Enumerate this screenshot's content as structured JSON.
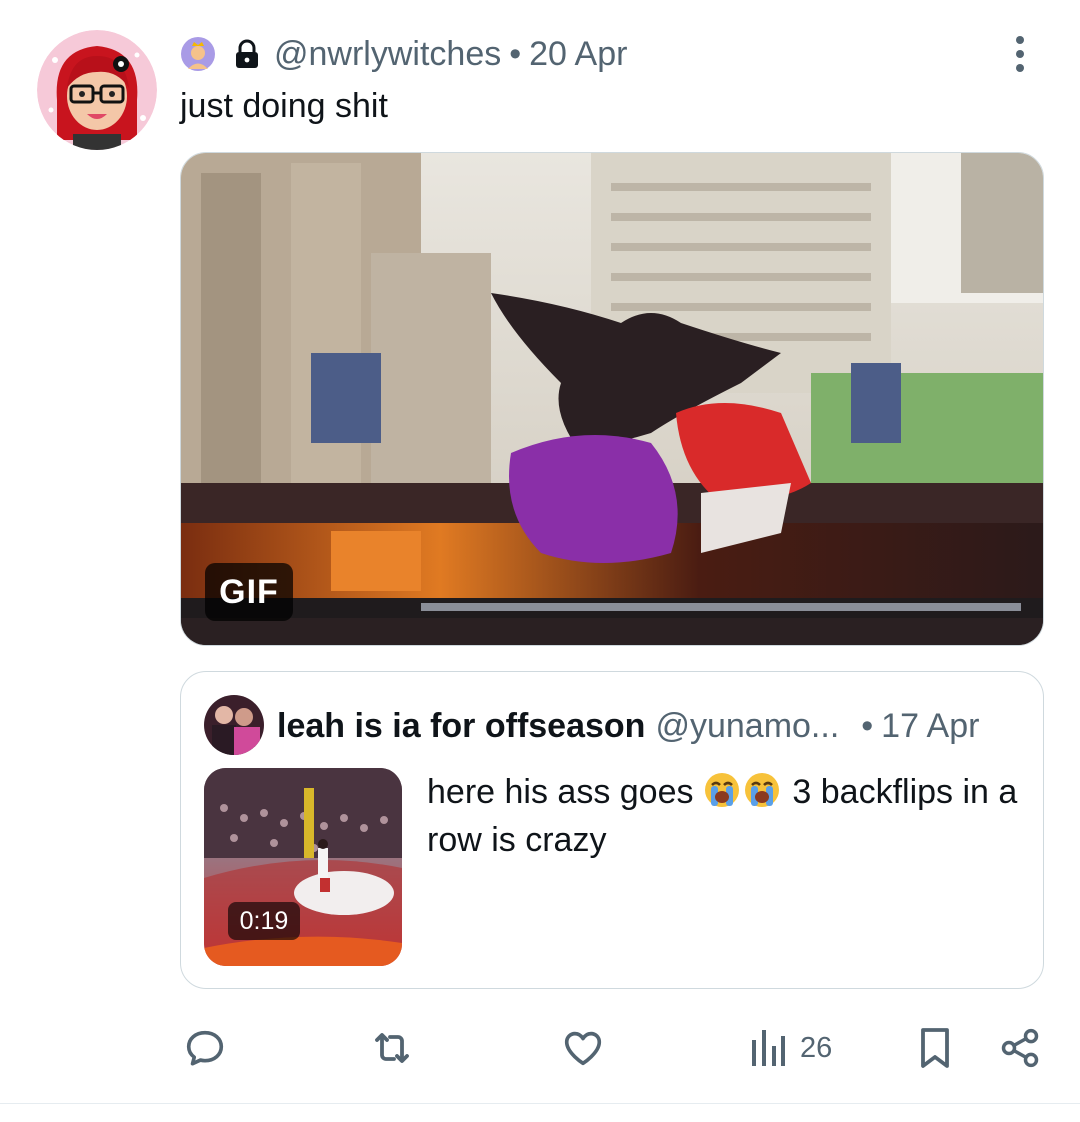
{
  "tweet": {
    "handle": "@nwrlywitches",
    "separator": "•",
    "date": "20 Apr",
    "text": "just doing shit",
    "badge_icon": "person-with-crown-emoji",
    "lock_icon": "lock-icon",
    "media": {
      "type": "gif",
      "badge_label": "GIF"
    }
  },
  "quote": {
    "name": "leah is ia for offseason",
    "handle": "@yunamo...",
    "separator": "•",
    "date": "17 Apr",
    "text_part1": "here his ass goes",
    "text_part2": "3 backflips in a row is crazy",
    "emoji": "loudly-crying-face-emoji",
    "emoji_count": 2,
    "video_duration": "0:19"
  },
  "actions": {
    "views": "26",
    "icons": [
      "reply-icon",
      "retweet-icon",
      "like-icon",
      "views-icon",
      "bookmark-icon",
      "share-icon"
    ]
  },
  "colors": {
    "text_primary": "#0f1419",
    "text_secondary": "#536471",
    "border": "#cfd9de"
  }
}
